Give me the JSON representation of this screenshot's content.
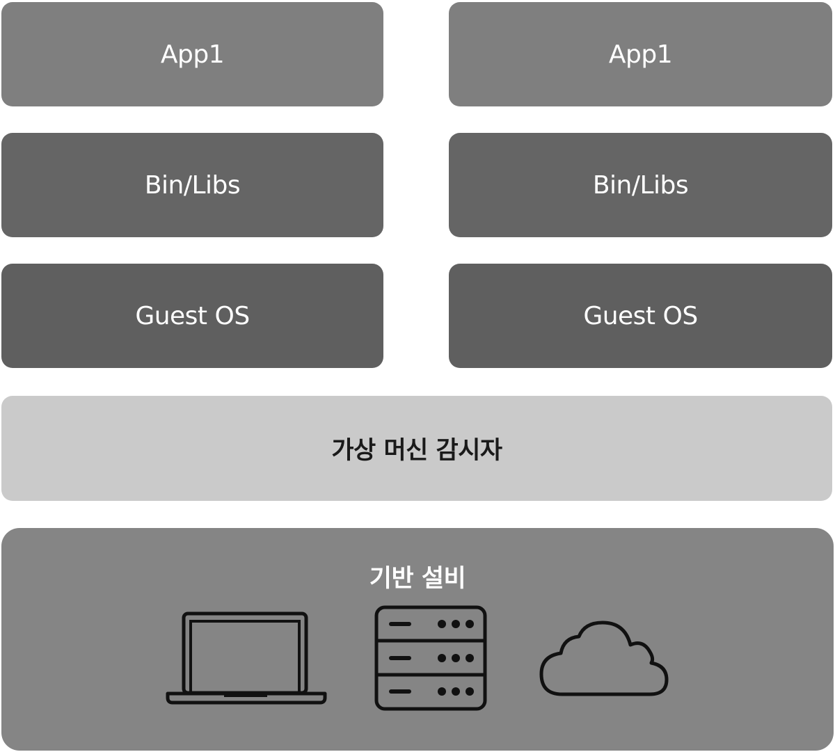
{
  "stacks": [
    {
      "app": "App1",
      "libs": "Bin/Libs",
      "os": "Guest OS"
    },
    {
      "app": "App1",
      "libs": "Bin/Libs",
      "os": "Guest OS"
    }
  ],
  "hypervisor": {
    "label": "가상 머신 감시자"
  },
  "infrastructure": {
    "label": "기반 설비",
    "icons": [
      "laptop-icon",
      "server-icon",
      "cloud-icon"
    ]
  }
}
